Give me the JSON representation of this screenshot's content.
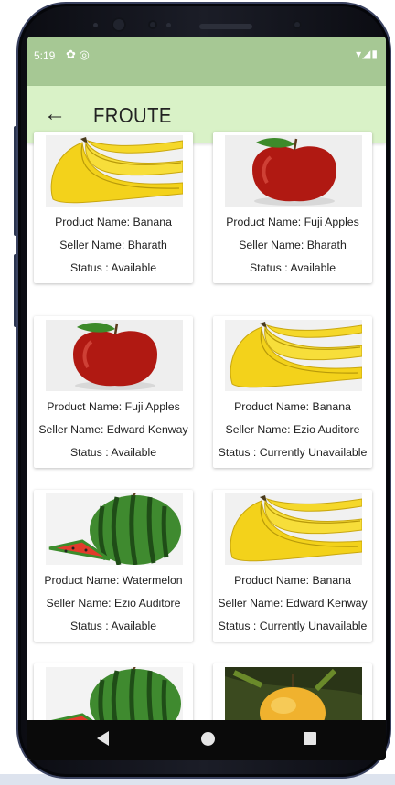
{
  "status_bar": {
    "time": "5:19",
    "left_icons": "✿ ◎",
    "right_icons": "▾◢▮"
  },
  "app_bar": {
    "back_icon": "arrow-back-icon",
    "title": "FROUTE"
  },
  "products": [
    {
      "image": "banana",
      "product_name": "Product Name: Banana",
      "seller_name": "Seller Name: Bharath",
      "status": "Status : Available"
    },
    {
      "image": "apple",
      "product_name": "Product Name: Fuji Apples",
      "seller_name": "Seller Name: Bharath",
      "status": "Status : Available"
    },
    {
      "image": "apple",
      "product_name": "Product Name: Fuji Apples",
      "seller_name": "Seller Name: Edward Kenway",
      "status": "Status : Available"
    },
    {
      "image": "banana",
      "product_name": "Product Name: Banana",
      "seller_name": "Seller Name: Ezio Auditore",
      "status": "Status : Currently Unavailable"
    },
    {
      "image": "watermelon",
      "product_name": "Product Name: Watermelon",
      "seller_name": "Seller Name: Ezio Auditore",
      "status": "Status : Available"
    },
    {
      "image": "banana",
      "product_name": "Product Name: Banana",
      "seller_name": "Seller Name: Edward Kenway",
      "status": "Status : Currently Unavailable"
    },
    {
      "image": "watermelon"
    },
    {
      "image": "mango"
    }
  ],
  "nav_bar": {
    "back": "nav-back-icon",
    "home": "nav-home-icon",
    "recents": "nav-recents-icon"
  },
  "colors": {
    "status_bar_bg": "#a6c894",
    "app_bar_bg": "#d9f2c7",
    "nav_bar_bg": "#0a0a0a"
  }
}
